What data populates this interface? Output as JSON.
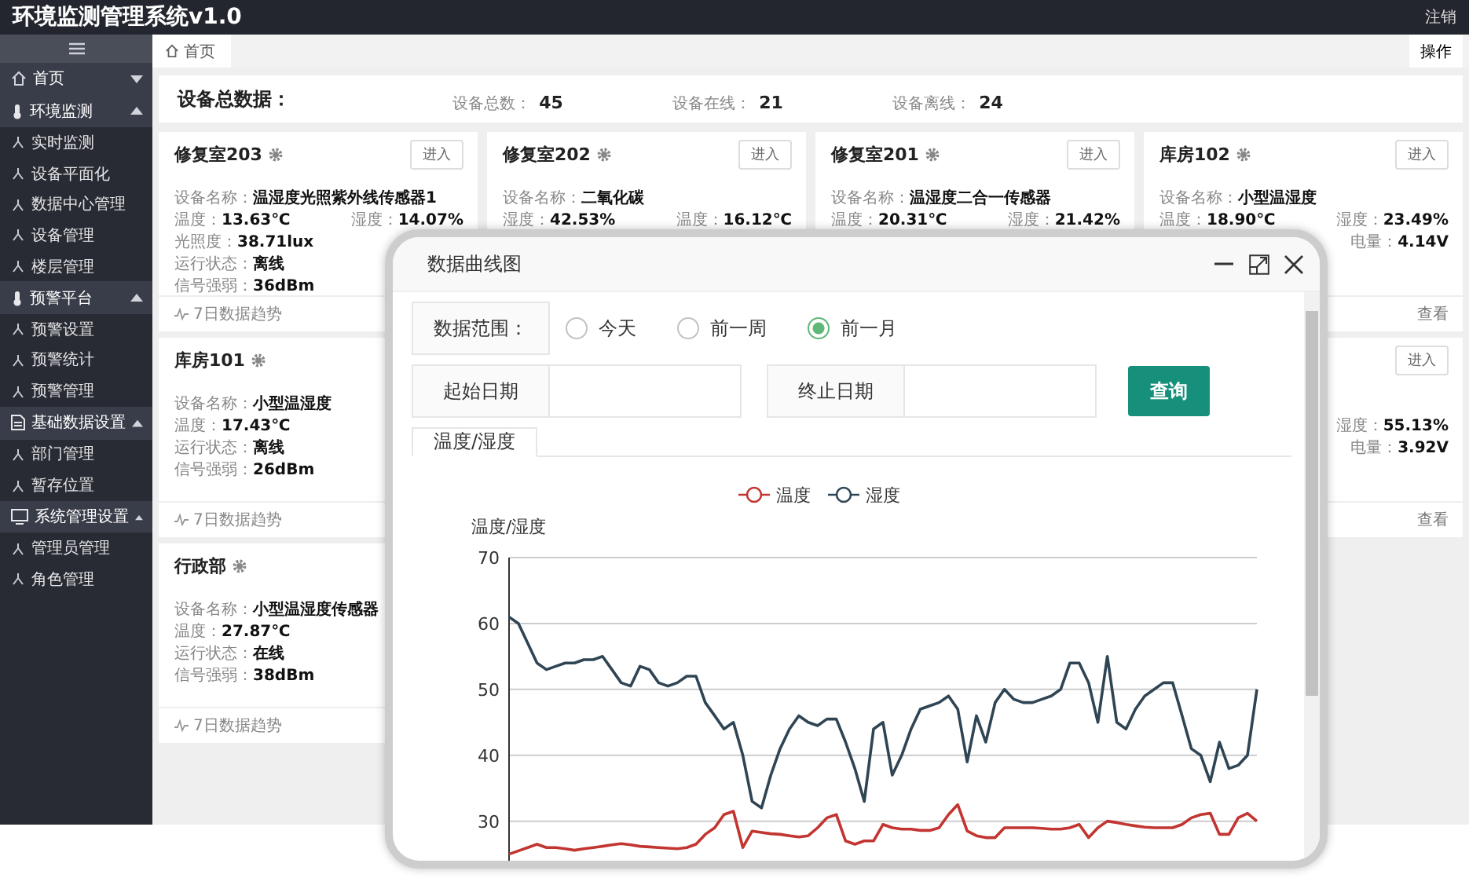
{
  "header": {
    "title": "环境监测管理系统v1.0",
    "logout": "注销"
  },
  "sidebar": {
    "items": [
      {
        "label": "首页",
        "expanded": false
      },
      {
        "label": "环境监测",
        "expanded": true,
        "children": [
          {
            "label": "实时监测"
          },
          {
            "label": "设备平面化"
          },
          {
            "label": "数据中心管理"
          },
          {
            "label": "设备管理"
          },
          {
            "label": "楼层管理"
          }
        ]
      },
      {
        "label": "预警平台",
        "expanded": true,
        "children": [
          {
            "label": "预警设置"
          },
          {
            "label": "预警统计"
          },
          {
            "label": "预警管理"
          }
        ]
      },
      {
        "label": "基础数据设置",
        "expanded": true,
        "children": [
          {
            "label": "部门管理"
          },
          {
            "label": "暂存位置"
          }
        ]
      },
      {
        "label": "系统管理设置",
        "expanded": true,
        "children": [
          {
            "label": "管理员管理"
          },
          {
            "label": "角色管理"
          }
        ]
      }
    ]
  },
  "tabs": [
    {
      "label": "首页",
      "selected": true
    }
  ],
  "actions_button": "操作",
  "summary": {
    "title": "设备总数据：",
    "stats": [
      {
        "label": "设备总数：",
        "value": "45"
      },
      {
        "label": "设备在线：",
        "value": "21"
      },
      {
        "label": "设备离线：",
        "value": "24"
      }
    ]
  },
  "cards": [
    {
      "kind": "full",
      "name": "修复室203",
      "enter": "进入",
      "lines": [
        {
          "label": "设备名称：",
          "value": "温湿度光照紫外线传感器1"
        },
        {
          "label": "温度：",
          "value": "13.63℃",
          "right_label": "湿度：",
          "right_value": "14.07%"
        },
        {
          "label": "光照度：",
          "value": "38.71lux"
        },
        {
          "label": "运行状态：",
          "value": "离线"
        },
        {
          "label": "信号强弱：",
          "value": "36dBm"
        }
      ],
      "trend": "7日数据趋势"
    },
    {
      "kind": "full",
      "name": "修复室202",
      "enter": "进入",
      "lines": [
        {
          "label": "设备名称：",
          "value": "二氧化碳"
        },
        {
          "label": "湿度：",
          "value": "42.53%",
          "right_label": "温度：",
          "right_value": "16.12℃"
        }
      ]
    },
    {
      "kind": "full",
      "name": "修复室201",
      "enter": "进入",
      "lines": [
        {
          "label": "设备名称：",
          "value": "温湿度二合一传感器"
        },
        {
          "label": "温度：",
          "value": "20.31℃",
          "right_label": "湿度：",
          "right_value": "21.42%"
        }
      ]
    },
    {
      "kind": "full",
      "name": "库房102",
      "enter": "进入",
      "lines": [
        {
          "label": "设备名称：",
          "value": "小型温湿度"
        },
        {
          "label": "温度：",
          "value": "18.90℃",
          "right_label": "湿度：",
          "right_value": "23.49%"
        },
        {
          "right_label": "电量：",
          "right_value": "4.14V"
        }
      ],
      "view": "查看"
    },
    {
      "kind": "full",
      "name": "库房101",
      "lines": [
        {
          "label": "设备名称：",
          "value": "小型温湿度"
        },
        {
          "label": "温度：",
          "value": "17.43℃"
        },
        {
          "label": "运行状态：",
          "value": "离线"
        },
        {
          "label": "信号强弱：",
          "value": "26dBm"
        }
      ],
      "trend": "7日数据趋势"
    },
    {
      "kind": "edge",
      "enter": "进入",
      "lines": [
        {
          "right_label": "湿度：",
          "right_value": "55.13%"
        },
        {
          "right_label": "电量：",
          "right_value": "3.92V"
        }
      ],
      "view": "查看"
    },
    {
      "kind": "full",
      "name": "行政部",
      "lines": [
        {
          "label": "设备名称：",
          "value": "小型温湿度传感器"
        },
        {
          "label": "温度：",
          "value": "27.87℃"
        },
        {
          "label": "运行状态：",
          "value": "在线"
        },
        {
          "label": "信号强弱：",
          "value": "38dBm"
        }
      ],
      "trend": "7日数据趋势"
    }
  ],
  "modal": {
    "title": "数据曲线图",
    "range": {
      "label": "数据范围：",
      "options": [
        {
          "label": "今天",
          "selected": false
        },
        {
          "label": "前一周",
          "selected": false
        },
        {
          "label": "前一月",
          "selected": true
        }
      ]
    },
    "start_label": "起始日期",
    "end_label": "终止日期",
    "query_button": "查询",
    "tabs": [
      {
        "label": "温度/湿度",
        "selected": true
      }
    ],
    "chart_data": {
      "type": "line",
      "grid": true,
      "legend": true,
      "ylabel": "温度/湿度",
      "ylim": [
        24,
        70
      ],
      "yticks": [
        30,
        40,
        50,
        60,
        70
      ],
      "series": [
        {
          "name": "温度",
          "color": "#c23531",
          "values": [
            25,
            25.5,
            26,
            26.5,
            26,
            26,
            25.8,
            25.6,
            25.8,
            26,
            26.2,
            26.4,
            26.6,
            26.4,
            26.2,
            26.1,
            26,
            25.9,
            25.8,
            26,
            26.5,
            28,
            29,
            31,
            31.5,
            26,
            28.5,
            28.3,
            28.1,
            28,
            27.8,
            27.6,
            27.8,
            29,
            30.5,
            31,
            27,
            26.5,
            27,
            27,
            29.5,
            29,
            28.8,
            28.8,
            28.6,
            28.6,
            29,
            31,
            32.5,
            28.5,
            27.8,
            27.5,
            27.5,
            29,
            29,
            29,
            29,
            28.9,
            28.8,
            28.8,
            29,
            29.5,
            27.5,
            29,
            30,
            29.8,
            29.5,
            29.3,
            29.1,
            29,
            29,
            29,
            29.5,
            30.5,
            31,
            31.2,
            28,
            28,
            30.5,
            31.2,
            30
          ]
        },
        {
          "name": "湿度",
          "color": "#2f4554",
          "values": [
            61,
            60,
            57,
            54,
            53,
            53.5,
            54,
            54,
            54.5,
            54.5,
            55,
            53,
            51,
            50.5,
            53.5,
            53,
            51,
            50.5,
            51,
            52,
            52,
            48,
            46,
            44,
            45,
            40,
            33,
            32,
            37,
            41,
            44,
            46,
            45,
            44.5,
            45.5,
            45.5,
            42,
            38,
            33,
            44,
            45,
            37,
            40,
            44,
            47,
            47.5,
            48,
            49,
            47,
            39,
            46,
            42,
            48,
            50,
            48.5,
            48,
            48,
            48.5,
            49,
            50,
            54,
            54,
            51,
            45,
            55,
            45,
            44,
            47,
            49,
            50,
            51,
            51,
            46,
            41,
            40,
            36,
            42,
            38,
            38.5,
            40,
            50
          ]
        }
      ]
    }
  }
}
